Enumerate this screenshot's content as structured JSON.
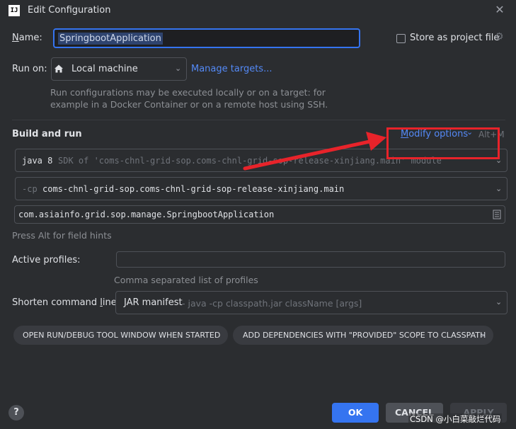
{
  "window": {
    "title": "Edit Configuration",
    "app_icon": "IJ",
    "close": "✕"
  },
  "name": {
    "label": "Name:",
    "label_underline": "N",
    "label_rest": "ame:",
    "value": "SpringbootApplication"
  },
  "store": {
    "label": "Store as project file",
    "checked": false
  },
  "run_on": {
    "label": "Run on:",
    "value": "Local machine",
    "manage_link": "Manage targets...",
    "hint_line1": "Run configurations may be executed locally or on a target: for",
    "hint_line2": "example in a Docker Container or on a remote host using SSH."
  },
  "build": {
    "title": "Build and run",
    "modify_options": "Modify options",
    "modify_options_underline": "M",
    "modify_options_rest": "odify options",
    "modify_shortcut": "Alt+M",
    "jdk_name": "java 8",
    "jdk_detail": "SDK of 'coms-chnl-grid-sop.coms-chnl-grid-sop-release-xinjiang.main' module",
    "cp_flag": "-cp",
    "cp_value": "coms-chnl-grid-sop.coms-chnl-grid-sop-release-xinjiang.main",
    "main_class": "com.asiainfo.grid.sop.manage.SpringbootApplication",
    "field_hint": "Press Alt for field hints"
  },
  "profiles": {
    "label": "Active profiles:",
    "value": "",
    "hint": "Comma separated list of profiles"
  },
  "shorten": {
    "label": "Shorten command line:",
    "label_pre": "Shorten command ",
    "label_underline": "l",
    "label_post": "ine:",
    "value": "JAR manifest",
    "detail": "- java -cp classpath.jar className [args]"
  },
  "options": [
    "OPEN RUN/DEBUG TOOL WINDOW WHEN STARTED",
    "ADD DEPENDENCIES WITH \"PROVIDED\" SCOPE TO CLASSPATH"
  ],
  "buttons": {
    "help": "?",
    "ok": "OK",
    "cancel": "CANCEL",
    "apply": "APPLY"
  },
  "watermark": "CSDN @小白菜敲烂代码",
  "colors": {
    "accent": "#3574f0",
    "annotation_red": "#e8232a",
    "background": "#2b2d30",
    "link": "#548af7"
  }
}
